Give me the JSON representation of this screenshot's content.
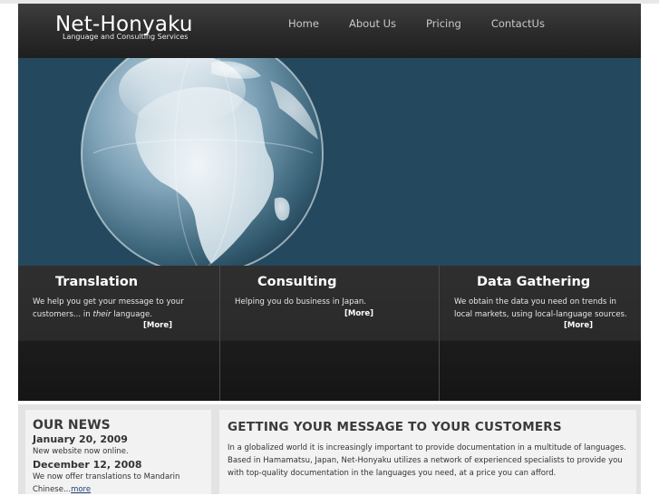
{
  "header": {
    "logo_title": "Net-Honyaku",
    "logo_subtitle": "Language and Consulting Services",
    "nav": [
      "Home",
      "About Us",
      "Pricing",
      "ContactUs"
    ]
  },
  "hero": {
    "image": "crystal-globe"
  },
  "features": [
    {
      "title": "Translation",
      "text_before": "We help you get your message to your customers... in ",
      "text_em": "their",
      "text_after": " language.",
      "more": "[More]"
    },
    {
      "title": "Consulting",
      "text": "Helping you do business in Japan.",
      "more": "[More]"
    },
    {
      "title": "Data Gathering",
      "text": "We obtain the data you need on trends in local markets, using local-language sources.",
      "more": "[More]"
    }
  ],
  "news": {
    "heading": "OUR NEWS",
    "items": [
      {
        "date": "January 20, 2009",
        "text": "New website now online."
      },
      {
        "date": "December 12, 2008",
        "text": "We now offer translations to Mandarin Chinese...",
        "link": "more"
      }
    ]
  },
  "article": {
    "heading": "GETTING YOUR MESSAGE TO YOUR CUSTOMERS",
    "body": "In a globalized world it is increasingly important to provide documentation in a multitude of languages. Based in Hamamatsu, Japan, Net-Honyaku utilizes a network of experienced specialists to provide you with top-quality documentation in the languages you need, at a price you can afford."
  },
  "colors": {
    "hero_background": "#24495e",
    "header_background": "#2c2c2c",
    "news_link": "#1d3f73"
  }
}
